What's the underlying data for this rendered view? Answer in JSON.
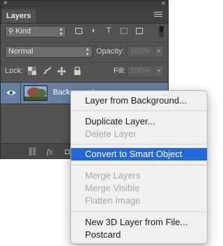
{
  "panel": {
    "close_glyph": "×",
    "collapse_glyph": "«",
    "tab_label": "Layers",
    "filter": {
      "kind_label": "Kind"
    },
    "blend": {
      "mode": "Normal",
      "opacity_label": "Opacity:",
      "opacity_value": "100%"
    },
    "lock": {
      "lock_label": "Lock:",
      "fill_label": "Fill:",
      "fill_value": "100%"
    },
    "layer": {
      "name": "Background"
    },
    "bottom_icons": [
      "link-icon",
      "fx-icon",
      "mask-icon"
    ]
  },
  "context_menu": {
    "items": [
      {
        "label": "Layer from Background...",
        "state": "enabled"
      },
      {
        "label": "Duplicate Layer...",
        "state": "enabled"
      },
      {
        "label": "Delete Layer",
        "state": "disabled"
      },
      {
        "label": "Convert to Smart Object",
        "state": "selected"
      },
      {
        "label": "Merge Layers",
        "state": "disabled"
      },
      {
        "label": "Merge Visible",
        "state": "disabled"
      },
      {
        "label": "Flatten Image",
        "state": "disabled"
      },
      {
        "label": "New 3D Layer from File...",
        "state": "enabled"
      },
      {
        "label": "Postcard",
        "state": "enabled"
      }
    ]
  },
  "colors": {
    "panel_bg": "#535353",
    "selected_layer": "#6780a1",
    "menu_highlight": "#2468d8"
  }
}
